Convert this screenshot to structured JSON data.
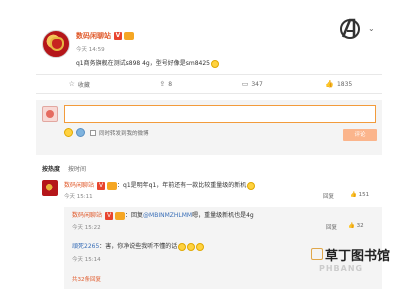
{
  "post": {
    "username": "数码闲聊站",
    "verified_badge": "V",
    "time": "今天 14:59",
    "text": "q1商务旗舰在测试s898 4g，型号好像是sm8425"
  },
  "actions": {
    "favorite": "收藏",
    "repost": "8",
    "comment": "347",
    "like": "1835"
  },
  "compose": {
    "placeholder": "",
    "also_repost_label": "同时转发到我的微博",
    "submit_label": "评论"
  },
  "sort_tabs": [
    "按热度",
    "按时间"
  ],
  "comment": {
    "user": "数码闲聊站",
    "verified_badge": "V",
    "text": "：q1是明年q1，年前还有一款比较重量级的新机",
    "time": "今天 15:11",
    "reply_label": "回复",
    "likes": "151"
  },
  "replies": [
    {
      "user": "数码闲聊站",
      "verified_badge": "V",
      "text_prefix": "：回复",
      "mention": "@MBINMZHLMM",
      "text_suffix": "嗯，重量级新机也是4g",
      "time": "今天 15:22",
      "reply_label": "回复",
      "likes": "32"
    },
    {
      "user": "頑死2265",
      "text": "：害，你净说些我听不懂的话",
      "time": "今天 15:14"
    }
  ],
  "more_replies": "共32条回复",
  "watermark": {
    "title": "草丁图书馆",
    "sub": "PHBANG"
  },
  "colors": {
    "username": "#e05a2b",
    "input_border": "#f29b3b",
    "submit_bg": "#fbb58c"
  }
}
